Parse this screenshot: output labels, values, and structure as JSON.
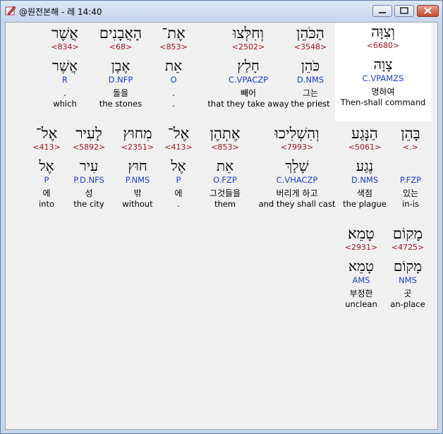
{
  "window": {
    "title": "@원전본해 - 레 14:40",
    "app_icon": "pencil-book-icon",
    "buttons": [
      "minimize-icon",
      "maximize-icon",
      "close-icon"
    ]
  },
  "rows": [
    [
      {
        "hebrew": "וְצִוָּה",
        "strong": "<6680>",
        "lemma": "צָוָה",
        "morph": "C.VPAMZS",
        "korean": "명하여",
        "english": "Then-shall command",
        "highlight": true
      },
      {
        "hebrew": "הַכֹּהֵן",
        "strong": "<3548>",
        "lemma": "כֹּהֵן",
        "morph": "D.NMS",
        "korean": "그는",
        "english": "the priest"
      },
      {
        "hebrew": "וְחִלְּצוּ",
        "strong": "<2502>",
        "lemma": "חָלַץ",
        "morph": "C.VPACZP",
        "korean": "빼어",
        "english": "that they take away"
      },
      {
        "hebrew": "אֶת־",
        "strong": "<853>",
        "lemma": "אֵת",
        "morph": "O",
        "korean": ".",
        "english": "."
      },
      {
        "hebrew": "הָאֲבָנִים",
        "strong": "<68>",
        "lemma": "אֶבֶן",
        "morph": "D.NFP",
        "korean": "돌을",
        "english": "the stones"
      },
      {
        "hebrew": "אֲשֶׁר",
        "strong": "<834>",
        "lemma": "אֲשֶׁר",
        "morph": "R",
        "korean": ".",
        "english": "which"
      }
    ],
    [
      {
        "hebrew": "בָּהֵן",
        "strong": "<.>",
        "lemma": "",
        "morph": "P.FZP",
        "korean": "있는",
        "english": "in-is"
      },
      {
        "hebrew": "הַנָּגַע",
        "strong": "<5061>",
        "lemma": "נֶגַע",
        "morph": "D.NMS",
        "korean": "색점",
        "english": "the plague"
      },
      {
        "hebrew": "וְהִשְׁלִיכוּ",
        "strong": "<7993>",
        "lemma": "שָׁלַךְ",
        "morph": "C.VHACZP",
        "korean": "버리게 하고",
        "english": "and they shall cast"
      },
      {
        "hebrew": "אֶתְהֶן",
        "strong": "<853>",
        "lemma": "אֵת",
        "morph": "O.FZP",
        "korean": "그것들을",
        "english": "them"
      },
      {
        "hebrew": "אֶל־",
        "strong": "<413>",
        "lemma": "אֶל",
        "morph": "P",
        "korean": "에",
        "english": "."
      },
      {
        "hebrew": "מִחוּץ",
        "strong": "<2351>",
        "lemma": "חוּץ",
        "morph": "P.NMS",
        "korean": "밖",
        "english": "without"
      },
      {
        "hebrew": "לָעִיר",
        "strong": "<5892>",
        "lemma": "עִיר",
        "morph": "P.D.NFS",
        "korean": "성",
        "english": "the city"
      },
      {
        "hebrew": "אֶל־",
        "strong": "<413>",
        "lemma": "אֶל",
        "morph": "P",
        "korean": "에",
        "english": "into"
      }
    ],
    [
      {
        "hebrew": "מָקוֹם",
        "strong": "<4725>",
        "lemma": "מָקוֹם",
        "morph": "NMS",
        "korean": "곳",
        "english": "an-place"
      },
      {
        "hebrew": "טָמֵא׃",
        "strong": "<2931>",
        "lemma": "טָמֵא",
        "morph": "AMS",
        "korean": "부정한",
        "english": "unclean"
      }
    ]
  ]
}
